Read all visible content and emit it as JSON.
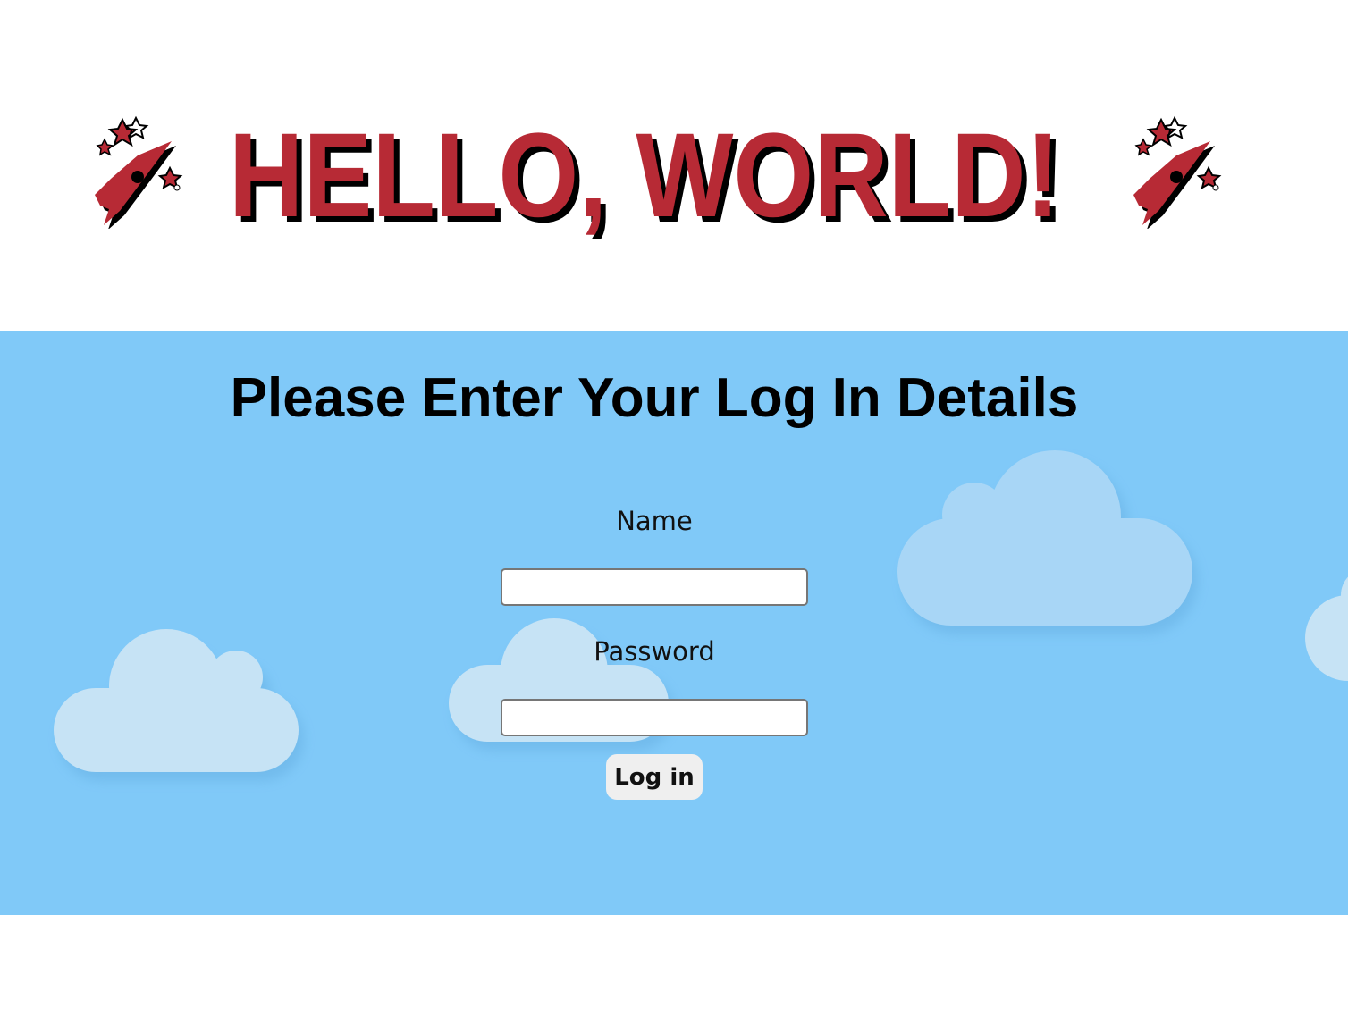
{
  "header": {
    "banner_text": "HELLO, WORLD!"
  },
  "login": {
    "heading": "Please Enter Your Log In Details",
    "name_label": "Name",
    "name_value": "",
    "password_label": "Password",
    "password_value": "",
    "submit_label": "Log in"
  },
  "colors": {
    "banner_red": "#b72a35",
    "banner_shadow": "#000000",
    "sky_blue": "#80c9f8",
    "cloud": "#c6e3f5"
  },
  "icons": {
    "left": "rocket-icon",
    "right": "rocket-icon"
  }
}
